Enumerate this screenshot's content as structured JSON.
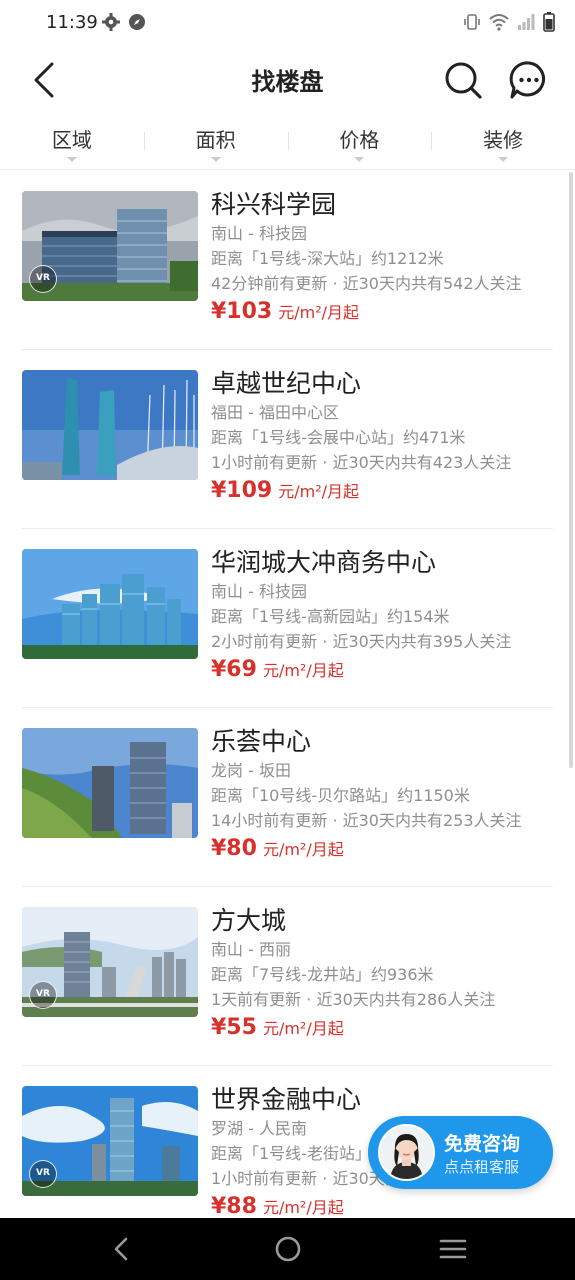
{
  "status_bar": {
    "time": "11:39"
  },
  "nav": {
    "title": "找楼盘"
  },
  "filters": [
    "区域",
    "面积",
    "价格",
    "装修"
  ],
  "listings": [
    {
      "name": "科兴科学园",
      "area": "南山 - 科技园",
      "distance": "距离「1号线-深大站」约1212米",
      "update": "42分钟前有更新 · 近30天内共有542人关注",
      "price": "¥103",
      "unit": "元/m²/月起",
      "vr": true
    },
    {
      "name": "卓越世纪中心",
      "area": "福田 - 福田中心区",
      "distance": "距离「1号线-会展中心站」约471米",
      "update": "1小时前有更新 · 近30天内共有423人关注",
      "price": "¥109",
      "unit": "元/m²/月起",
      "vr": false
    },
    {
      "name": "华润城大冲商务中心",
      "area": "南山 - 科技园",
      "distance": "距离「1号线-高新园站」约154米",
      "update": "2小时前有更新 · 近30天内共有395人关注",
      "price": "¥69",
      "unit": "元/m²/月起",
      "vr": false
    },
    {
      "name": "乐荟中心",
      "area": "龙岗 - 坂田",
      "distance": "距离「10号线-贝尔路站」约1150米",
      "update": "14小时前有更新 · 近30天内共有253人关注",
      "price": "¥80",
      "unit": "元/m²/月起",
      "vr": false
    },
    {
      "name": "方大城",
      "area": "南山 - 西丽",
      "distance": "距离「7号线-龙井站」约936米",
      "update": "1天前有更新 · 近30天内共有286人关注",
      "price": "¥55",
      "unit": "元/m²/月起",
      "vr": true
    },
    {
      "name": "世界金融中心",
      "area": "罗湖 - 人民南",
      "distance": "距离「1号线-老街站」约3",
      "update": "1小时前有更新 · 近30天内共有",
      "price": "¥88",
      "unit": "元/m²/月起",
      "vr": true
    }
  ],
  "vr_badge": "VR",
  "consult": {
    "title": "免费咨询",
    "subtitle": "点点租客服"
  },
  "colors": {
    "price": "#d8312c",
    "consult_bg": "#1f97ea"
  }
}
